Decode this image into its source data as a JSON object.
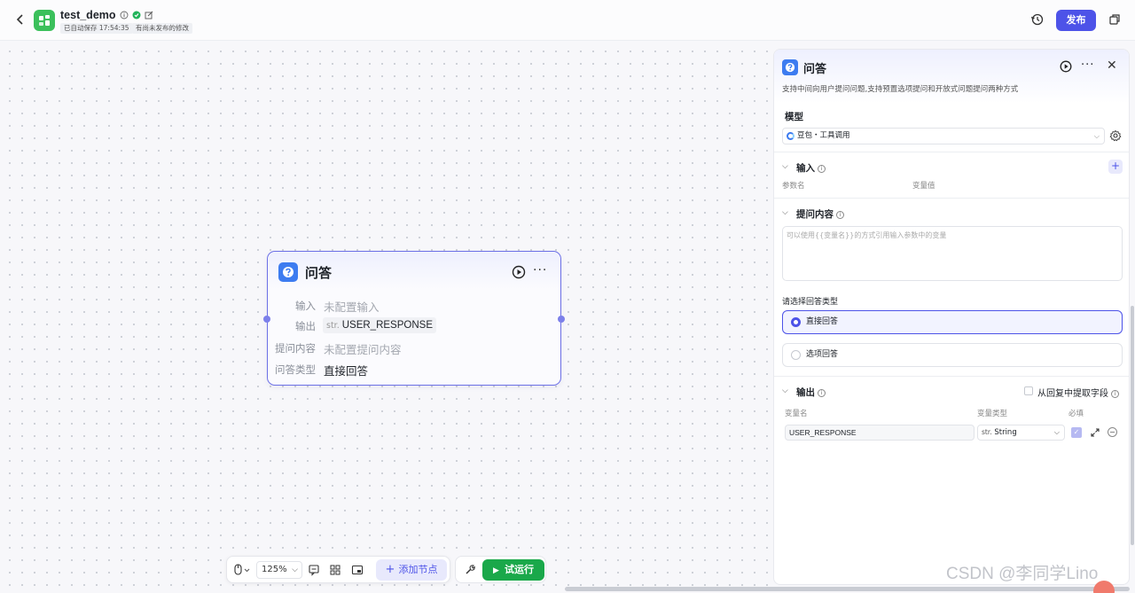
{
  "header": {
    "app_name": "test_demo",
    "autosave_text": "已自动保存 17:54:35",
    "unpublished_text": "有尚未发布的修改",
    "publish_label": "发布",
    "icons": [
      "back-arrow-icon",
      "app-logo-icon",
      "info-icon",
      "verified-icon",
      "edit-icon",
      "history-icon",
      "copy-icon"
    ]
  },
  "node": {
    "title": "问答",
    "rows": [
      {
        "label": "输入",
        "value": "未配置输入"
      },
      {
        "label": "输出",
        "type": "str.",
        "value": "USER_RESPONSE"
      },
      {
        "label": "提问内容",
        "value": "未配置提问内容"
      },
      {
        "label": "问答类型",
        "value": "直接回答"
      }
    ]
  },
  "toolbar": {
    "zoom": "125%",
    "add_node_label": "添加节点",
    "run_label": "试运行"
  },
  "panel": {
    "title": "问答",
    "description": "支持中间向用户提问问题,支持预置选项提问和开放式问题提问两种方式",
    "model": {
      "section_title": "模型",
      "selected": "豆包・工具调用"
    },
    "input": {
      "section_title": "输入",
      "col_name": "参数名",
      "col_value": "变量值"
    },
    "prompt": {
      "section_title": "提问内容",
      "placeholder": "可以使用{{变量名}}的方式引用输入参数中的变量"
    },
    "answer_type": {
      "label": "请选择回答类型",
      "options": [
        "直接回答",
        "选项回答"
      ],
      "selected_index": 0
    },
    "output": {
      "section_title": "输出",
      "extract_label": "从回复中提取字段",
      "col_name": "变量名",
      "col_type": "变量类型",
      "col_required": "必填",
      "row": {
        "name": "USER_RESPONSE",
        "type_tag": "str.",
        "type": "String",
        "required": true
      }
    }
  },
  "watermark": "CSDN @李同学Lino",
  "colors": {
    "accent": "#4d53e8",
    "run_green": "#1aa84a",
    "node_icon_blue": "#3d7cf0",
    "app_logo_green": "#3bc05b"
  }
}
